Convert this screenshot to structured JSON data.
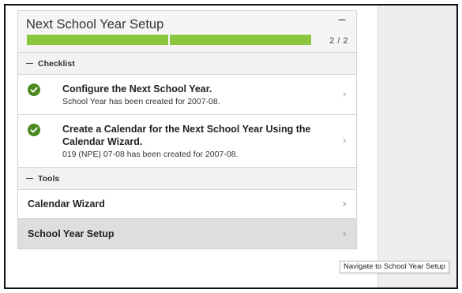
{
  "card": {
    "title": "Next School Year Setup",
    "progress": {
      "completed": 2,
      "total": 2,
      "label": "2 / 2"
    }
  },
  "checklist": {
    "header": "Checklist",
    "tasks": [
      {
        "title": "Configure the Next School Year.",
        "subtitle": "School Year has been created for 2007-08.",
        "status": "complete"
      },
      {
        "title": "Create a Calendar for the Next School Year Using the Calendar Wizard.",
        "subtitle": "019 (NPE) 07-08 has been created for 2007-08.",
        "status": "complete"
      }
    ]
  },
  "tools": {
    "header": "Tools",
    "items": [
      {
        "label": "Calendar Wizard"
      },
      {
        "label": "School Year Setup"
      }
    ]
  },
  "tooltip": {
    "text": "Navigate to School Year Setup"
  },
  "colors": {
    "progress": "#8cc63f",
    "check": "#4b8a1f",
    "active_row": "#dedede"
  }
}
